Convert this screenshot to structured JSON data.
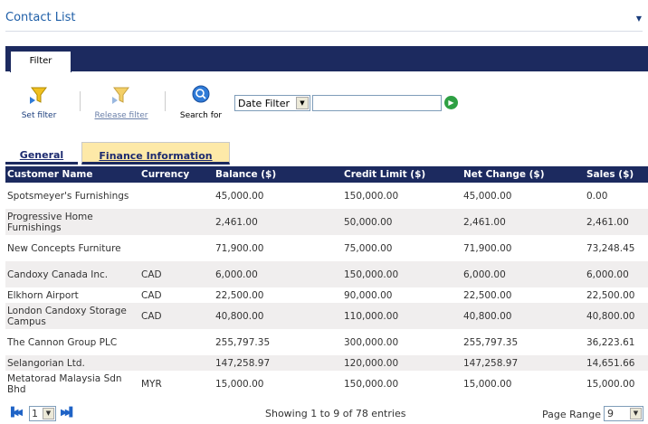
{
  "header": {
    "title": "Contact List",
    "chevron_icon": "chevron-down-icon"
  },
  "filterbar": {
    "tab_label": "Filter"
  },
  "tools": {
    "set_filter": "Set filter",
    "release_filter": "Release filter",
    "search_for": "Search for",
    "date_filter_value": "Date Filter",
    "date_filter_input_value": ""
  },
  "tabs": {
    "general": "General",
    "finance": "Finance Information"
  },
  "table": {
    "columns": [
      "Customer Name",
      "Currency",
      "Balance ($)",
      "Credit Limit ($)",
      "Net Change ($)",
      "Sales ($)"
    ],
    "rows": [
      [
        "Spotsmeyer's Furnishings",
        "",
        "45,000.00",
        "150,000.00",
        "45,000.00",
        "0.00"
      ],
      [
        "Progressive Home Furnishings",
        "",
        "2,461.00",
        "50,000.00",
        "2,461.00",
        "2,461.00"
      ],
      [
        "New Concepts Furniture",
        "",
        "71,900.00",
        "75,000.00",
        "71,900.00",
        "73,248.45"
      ],
      [
        "Candoxy Canada Inc.",
        "CAD",
        "6,000.00",
        "150,000.00",
        "6,000.00",
        "6,000.00"
      ],
      [
        "Elkhorn Airport",
        "CAD",
        "22,500.00",
        "90,000.00",
        "22,500.00",
        "22,500.00"
      ],
      [
        "London Candoxy Storage Campus",
        "CAD",
        "40,800.00",
        "110,000.00",
        "40,800.00",
        "40,800.00"
      ],
      [
        "The Cannon Group PLC",
        "",
        "255,797.35",
        "300,000.00",
        "255,797.35",
        "36,223.61"
      ],
      [
        "Selangorian Ltd.",
        "",
        "147,258.97",
        "120,000.00",
        "147,258.97",
        "14,651.66"
      ],
      [
        "Metatorad Malaysia Sdn Bhd",
        "MYR",
        "15,000.00",
        "150,000.00",
        "15,000.00",
        "15,000.00"
      ]
    ]
  },
  "footer": {
    "page_value": "1",
    "showing": "Showing 1 to 9 of 78 entries",
    "range_label": "Page Range",
    "range_value": "9"
  },
  "colors": {
    "header_bg": "#1c2a5f",
    "tab_active_bg": "#fde9a8",
    "title": "#1f5fa8"
  }
}
